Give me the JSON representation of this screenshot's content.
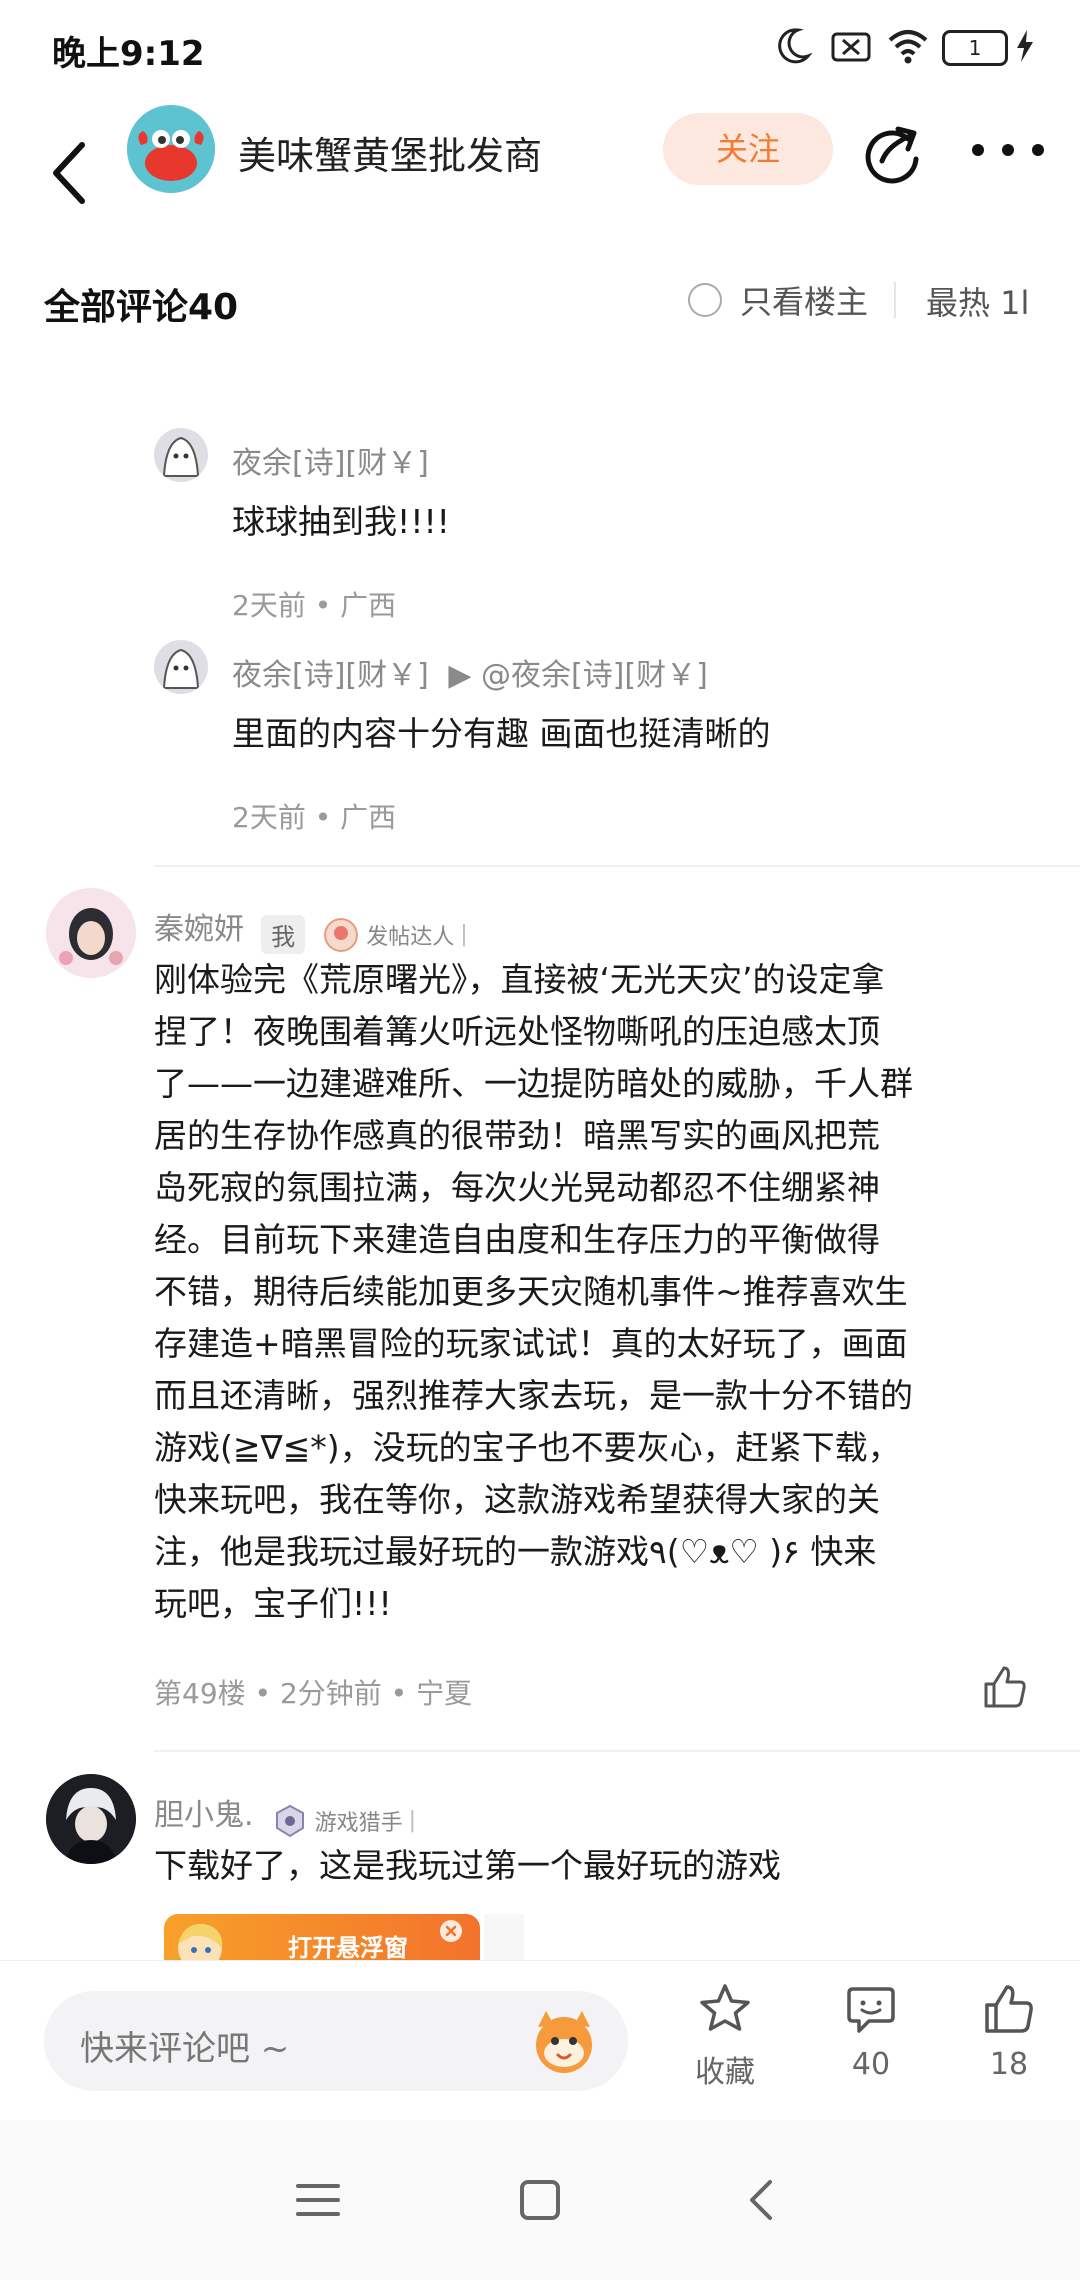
{
  "status_bar": {
    "time": "晚上9:12",
    "battery": "1",
    "icons": [
      "moon-icon",
      "sim-off-icon",
      "wifi-icon",
      "battery-icon",
      "charging-icon"
    ]
  },
  "header": {
    "title": "美味蟹黄堡批发商",
    "follow_label": "关注",
    "icons": [
      "back-icon",
      "share-icon",
      "more-icon"
    ]
  },
  "comments_header": {
    "title": "全部评论40",
    "only_owner_label": "只看楼主",
    "sort_label": "最热 1l"
  },
  "replies": [
    {
      "author": "夜余[诗][财￥]",
      "text": "球球抽到我!!!!",
      "meta": "2天前 • 广西"
    },
    {
      "author": "夜余[诗][财￥]",
      "reply_to": "▶ @夜余[诗][财￥]",
      "text": "里面的内容十分有趣 画面也挺清晰的",
      "meta": "2天前 • 广西"
    }
  ],
  "comments": [
    {
      "author": "秦婉妍",
      "me_tag": "我",
      "badge": "发帖达人",
      "text_lines": [
        "刚体验完《荒原曙光》，直接被‘无光天灾’的设定拿",
        "捏了！夜晚围着篝火听远处怪物嘶吼的压迫感太顶",
        "了——一边建避难所、一边提防暗处的威胁，千人群",
        "居的生存协作感真的很带劲！暗黑写实的画风把荒",
        "岛死寂的氛围拉满，每次火光晃动都忍不住绷紧神",
        "经。目前玩下来建造自由度和生存压力的平衡做得",
        "不错，期待后续能加更多天灾随机事件~推荐喜欢生",
        "存建造+暗黑冒险的玩家试试！真的太好玩了，画面",
        "而且还清晰，强烈推荐大家去玩，是一款十分不错的",
        "游戏(≧∇≦*)，没玩的宝子也不要灰心，赶紧下载，",
        "快来玩吧，我在等你，这款游戏希望获得大家的关",
        "注，他是我玩过最好玩的一款游戏٩(♡ᴥ♡ )۶ 快来",
        "玩吧，宝子们!!!"
      ],
      "meta": "第49楼 • 2分钟前 • 宁夏"
    },
    {
      "author": "胆小鬼.",
      "badge": "游戏猎手",
      "text": "下载好了，这是我玩过第一个最好玩的游戏",
      "image_overlay": "打开悬浮窗"
    }
  ],
  "bottom_bar": {
    "input_placeholder": "快来评论吧 ~",
    "favorite_label": "收藏",
    "comment_count": "40",
    "like_count": "18"
  },
  "colors": {
    "accent": "#f47a34",
    "follow_bg": "#fde8df"
  }
}
